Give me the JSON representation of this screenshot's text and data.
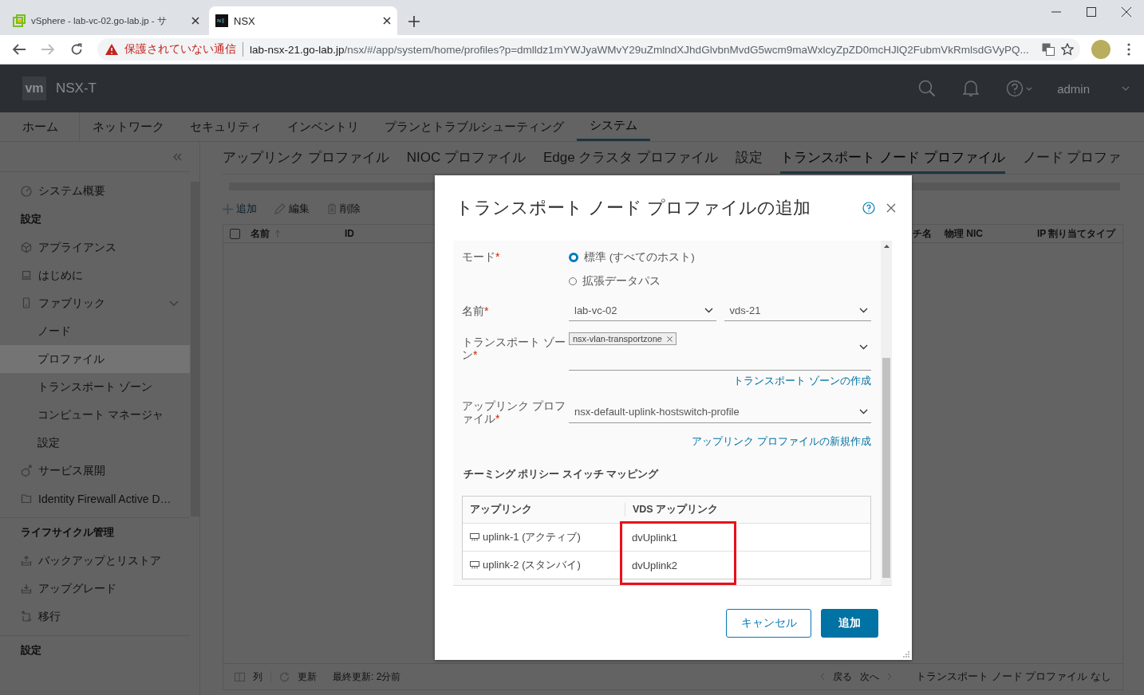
{
  "browser": {
    "tabs": [
      {
        "title": "vSphere - lab-vc-02.go-lab.jp - サ",
        "selected": false
      },
      {
        "title": "NSX",
        "selected": true
      }
    ],
    "security_label": "保護されていない通信",
    "url_host": "lab-nsx-21.go-lab.jp",
    "url_path": "/nsx/#/app/system/home/profiles?p=dmlldz1mYWJyaWMvY29uZmlndXJhdGlvbnMvdG5wcm9maWxlcyZpZD0mcHJlQ2FubmVkRmlsdGVyPQ..."
  },
  "header": {
    "logo": "vm",
    "product": "NSX-T",
    "user": "admin"
  },
  "nav": [
    {
      "label": "ホーム",
      "selected": false
    },
    {
      "label": "ネットワーク",
      "selected": false
    },
    {
      "label": "セキュリティ",
      "selected": false
    },
    {
      "label": "インベントリ",
      "selected": false
    },
    {
      "label": "プランとトラブルシューティング",
      "selected": false
    },
    {
      "label": "システム",
      "selected": true
    }
  ],
  "sidebar": {
    "items": [
      {
        "kind": "link",
        "label": "システム概要",
        "selected": false
      },
      {
        "kind": "heading",
        "label": "設定"
      },
      {
        "kind": "link",
        "label": "アプライアンス",
        "selected": false
      },
      {
        "kind": "link",
        "label": "はじめに",
        "selected": false
      },
      {
        "kind": "group",
        "label": "ファブリック",
        "expanded": true,
        "children": [
          {
            "label": "ノード",
            "selected": false
          },
          {
            "label": "プロファイル",
            "selected": true
          },
          {
            "label": "トランスポート ゾーン",
            "selected": false
          },
          {
            "label": "コンピュート マネージャ",
            "selected": false
          },
          {
            "label": "設定",
            "selected": false
          }
        ]
      },
      {
        "kind": "link",
        "label": "サービス展開",
        "selected": false
      },
      {
        "kind": "link",
        "label": "Identity Firewall Active D…",
        "selected": false
      },
      {
        "kind": "heading",
        "label": "ライフサイクル管理"
      },
      {
        "kind": "link",
        "label": "バックアップとリストア",
        "selected": false
      },
      {
        "kind": "link",
        "label": "アップグレード",
        "selected": false
      },
      {
        "kind": "link",
        "label": "移行",
        "selected": false
      },
      {
        "kind": "heading",
        "label": "設定"
      }
    ]
  },
  "subtabs": [
    {
      "label": "アップリンク プロファイル",
      "selected": false
    },
    {
      "label": "NIOC プロファイル",
      "selected": false
    },
    {
      "label": "Edge クラスタ プロファイル",
      "selected": false
    },
    {
      "label": "設定",
      "selected": false
    },
    {
      "label": "トランスポート ノード プロファイル",
      "selected": true
    },
    {
      "label": "ノード プロファ",
      "selected": false
    }
  ],
  "toolbar": [
    {
      "kind": "add",
      "label": "追加"
    },
    {
      "kind": "edit",
      "label": "編集"
    },
    {
      "kind": "delete",
      "label": "削除"
    }
  ],
  "table": {
    "select_all_checked": false,
    "columns": [
      {
        "label": "名前",
        "sorted": true
      },
      {
        "label": "ID",
        "sorted": false
      },
      {
        "label": "チ名",
        "sorted": false
      },
      {
        "label": "物理 NIC",
        "sorted": false
      },
      {
        "label": "IP 割り当てタイプ",
        "sorted": false
      }
    ],
    "footer": {
      "columns": "列",
      "refresh": "更新",
      "last_updated": "最終更新: 2分前",
      "back": "戻る",
      "next": "次へ",
      "summary": "トランスポート ノード プロファイル なし"
    }
  },
  "dialog": {
    "title": "トランスポート ノード プロファイルの追加",
    "mode": {
      "label": "モード",
      "required_mark": "*",
      "options": [
        {
          "label": "標準 (すべてのホスト)",
          "selected": true
        },
        {
          "label": "拡張データパス",
          "selected": false
        }
      ]
    },
    "name": {
      "label": "名前",
      "required_mark": "*",
      "selects": [
        "lab-vc-02",
        "vds-21"
      ]
    },
    "transport_zone": {
      "label": "トランスポート ゾーン",
      "required_mark": "*",
      "chips": [
        "nsx-vlan-transportzone"
      ],
      "link": "トランスポート ゾーンの作成"
    },
    "uplink_profile": {
      "label": "アップリンク プロファイル",
      "required_mark": "*",
      "value": "nsx-default-uplink-hostswitch-profile",
      "link": "アップリンク プロファイルの新規作成"
    },
    "mapping": {
      "title": "チーミング ポリシー スイッチ マッピング",
      "columns": [
        "アップリンク",
        "VDS アップリンク"
      ],
      "highlight_vds_column": true,
      "rows": [
        {
          "uplink": "uplink-1 (アクティブ)",
          "vds_uplink": "dvUplink1"
        },
        {
          "uplink": "uplink-2 (スタンバイ)",
          "vds_uplink": "dvUplink2"
        }
      ]
    },
    "buttons": [
      {
        "kind": "secondary",
        "label": "キャンセル"
      },
      {
        "kind": "primary",
        "label": "追加"
      }
    ]
  }
}
